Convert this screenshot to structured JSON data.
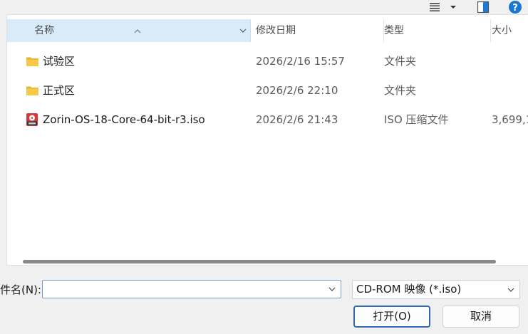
{
  "toolbar": {
    "view_icon": "view-list-icon",
    "dropdown_icon": "chevron-down-icon",
    "pane_icon": "preview-pane-icon",
    "help_label": "?"
  },
  "columns": {
    "name": "名称",
    "date": "修改日期",
    "type": "类型",
    "size": "大小"
  },
  "files": [
    {
      "icon": "folder-icon",
      "name": "试验区",
      "date": "2026/2/16 15:57",
      "type": "文件夹",
      "size": ""
    },
    {
      "icon": "folder-icon",
      "name": "正式区",
      "date": "2026/2/6 22:10",
      "type": "文件夹",
      "size": ""
    },
    {
      "icon": "iso-file-icon",
      "name": "Zorin-OS-18-Core-64-bit-r3.iso",
      "date": "2026/2/6 21:43",
      "type": "ISO 压缩文件",
      "size": "3,699,1"
    }
  ],
  "form": {
    "filename_label": "件名(N):",
    "filename_value": "",
    "filter_selected": "CD-ROM 映像 (*.iso)",
    "open_label": "打开(O)",
    "cancel_label": "取消"
  },
  "colors": {
    "accent": "#2f6ab3",
    "header_selected": "#d9ebf9",
    "folder": "#f7c948",
    "help": "#1976d2"
  }
}
